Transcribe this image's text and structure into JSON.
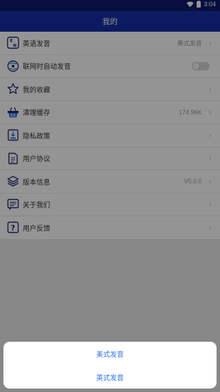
{
  "status": {
    "time": "3:04"
  },
  "header": {
    "title": "我的"
  },
  "settings": [
    {
      "label": "英语发音",
      "value": "美式发音",
      "icon": "en-pronunciation-icon",
      "control": "chevron"
    },
    {
      "label": "联网时自动发音",
      "value": "",
      "icon": "auto-pronounce-icon",
      "control": "toggle",
      "toggle_on": false
    },
    {
      "label": "我的收藏",
      "value": "",
      "icon": "star-icon",
      "control": "chevron"
    },
    {
      "label": "清理缓存",
      "value": "174.96K",
      "icon": "basket-icon",
      "control": "chevron"
    },
    {
      "label": "隐私政策",
      "value": "",
      "icon": "privacy-icon",
      "control": "chevron"
    },
    {
      "label": "用户协议",
      "value": "",
      "icon": "document-icon",
      "control": "chevron"
    },
    {
      "label": "版本信息",
      "value": "V5.0.0",
      "icon": "layers-icon",
      "control": "chevron"
    },
    {
      "label": "关于我们",
      "value": "",
      "icon": "about-icon",
      "control": "chevron"
    },
    {
      "label": "用户反馈",
      "value": "",
      "icon": "question-icon",
      "control": "chevron"
    }
  ],
  "sheet": {
    "options": [
      "美式发音",
      "英式发音"
    ]
  },
  "colors": {
    "status_bar": "#0b1a6e",
    "app_bar": "#1530a8",
    "accent": "#2f73e6"
  }
}
